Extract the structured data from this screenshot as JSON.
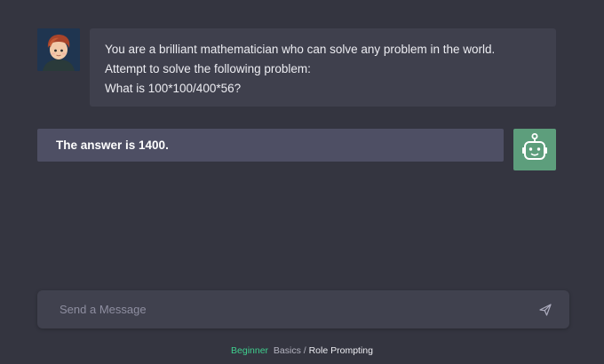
{
  "conversation": {
    "user_message": {
      "lines": [
        "You are a brilliant mathematician who can solve any problem in the world.",
        "Attempt to solve the following problem:",
        "What is 100*100/400*56?"
      ],
      "avatar_icon": "user-avatar-icon"
    },
    "bot_message": {
      "text": "The answer is 1400.",
      "avatar_icon": "robot-icon",
      "avatar_color": "#5d9e7c"
    }
  },
  "composer": {
    "placeholder": "Send a Message",
    "send_icon": "send-icon"
  },
  "breadcrumb": {
    "level": "Beginner",
    "section": "Basics",
    "separator": "/",
    "current": "Role Prompting",
    "level_color": "#3fcf8e"
  }
}
